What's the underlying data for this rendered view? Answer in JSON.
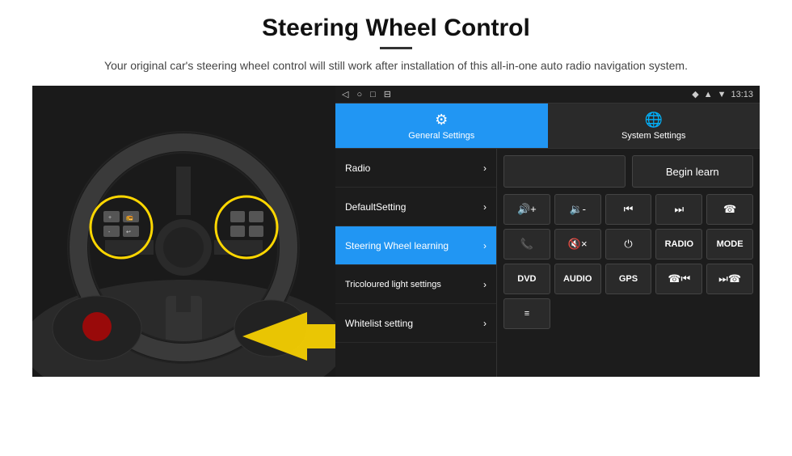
{
  "header": {
    "title": "Steering Wheel Control",
    "subtitle": "Your original car's steering wheel control will still work after installation of this all-in-one auto radio navigation system."
  },
  "status_bar": {
    "time": "13:13",
    "icons": [
      "◁",
      "○",
      "□",
      "⊟"
    ]
  },
  "tabs": [
    {
      "id": "general",
      "label": "General Settings",
      "icon": "⚙",
      "active": true
    },
    {
      "id": "system",
      "label": "System Settings",
      "icon": "🌐",
      "active": false
    }
  ],
  "menu_items": [
    {
      "id": "radio",
      "label": "Radio",
      "selected": false
    },
    {
      "id": "default",
      "label": "DefaultSetting",
      "selected": false
    },
    {
      "id": "steering",
      "label": "Steering Wheel learning",
      "selected": true
    },
    {
      "id": "tricoloured",
      "label": "Tricoloured light settings",
      "selected": false
    },
    {
      "id": "whitelist",
      "label": "Whitelist setting",
      "selected": false
    }
  ],
  "controls": {
    "begin_learn": "Begin learn",
    "row1": [
      {
        "id": "vol-up",
        "icon": "🔊+",
        "text": "🔊+"
      },
      {
        "id": "vol-down",
        "icon": "🔉-",
        "text": "🔉-"
      },
      {
        "id": "prev-track",
        "icon": "⏮",
        "text": "⏮"
      },
      {
        "id": "next-track",
        "icon": "⏭",
        "text": "⏭"
      },
      {
        "id": "phone",
        "icon": "☎",
        "text": "☎"
      }
    ],
    "row2": [
      {
        "id": "answer",
        "icon": "📞",
        "text": "📞"
      },
      {
        "id": "mute",
        "icon": "🔇",
        "text": "🔇×"
      },
      {
        "id": "power",
        "icon": "⏻",
        "text": "⏻"
      },
      {
        "id": "radio-btn",
        "icon": "RADIO",
        "text": "RADIO"
      },
      {
        "id": "mode",
        "icon": "MODE",
        "text": "MODE"
      }
    ],
    "row3": [
      {
        "id": "dvd",
        "text": "DVD"
      },
      {
        "id": "audio",
        "text": "AUDIO"
      },
      {
        "id": "gps",
        "text": "GPS"
      },
      {
        "id": "phone2",
        "text": "☎⏮"
      },
      {
        "id": "skip2",
        "text": "⏭☎"
      }
    ],
    "row4": [
      {
        "id": "menu-icon",
        "text": "≡"
      }
    ]
  }
}
